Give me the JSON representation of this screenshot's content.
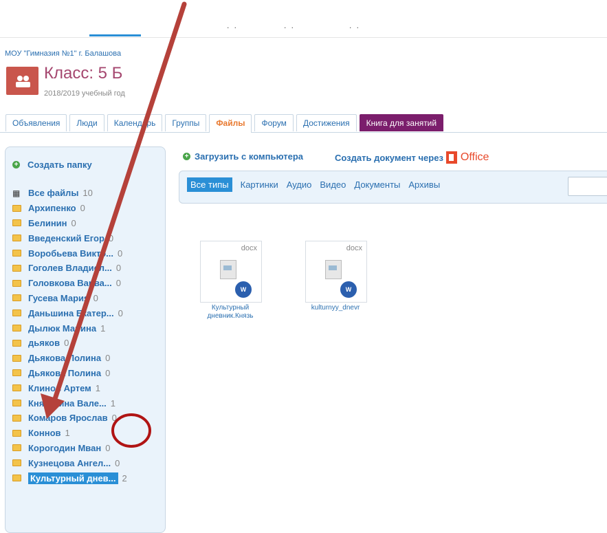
{
  "header": {
    "school": "МОУ \"Гимназия №1\" г. Балашова",
    "class_title": "Класс: 5 Б",
    "year": "2018/2019 учебный год"
  },
  "tabs": [
    {
      "label": "Объявления"
    },
    {
      "label": "Люди"
    },
    {
      "label": "Календарь"
    },
    {
      "label": "Группы"
    },
    {
      "label": "Файлы"
    },
    {
      "label": "Форум"
    },
    {
      "label": "Достижения"
    },
    {
      "label": "Книга для занятий"
    }
  ],
  "sidebar": {
    "create_folder": "Создать папку",
    "all_files": {
      "name": "Все файлы",
      "count": "10"
    },
    "folders": [
      {
        "name": "Архипенко",
        "count": "0"
      },
      {
        "name": "Белинин",
        "count": "0"
      },
      {
        "name": "Введенский Егор",
        "count": "0"
      },
      {
        "name": "Воробьева Викто...",
        "count": "0"
      },
      {
        "name": "Гоголев Владисл...",
        "count": "0"
      },
      {
        "name": "Головкова Варва...",
        "count": "0"
      },
      {
        "name": "Гусева Мария",
        "count": "0"
      },
      {
        "name": "Даньшина Екатер...",
        "count": "0"
      },
      {
        "name": "Дылюк Марина",
        "count": "1"
      },
      {
        "name": "дьяков",
        "count": "0"
      },
      {
        "name": "Дьякова Полина",
        "count": "0"
      },
      {
        "name": "Дьякова Полина",
        "count": "0"
      },
      {
        "name": "Клинов Артем",
        "count": "1"
      },
      {
        "name": "Князькина Вале...",
        "count": "1"
      },
      {
        "name": "Комаров Ярослав",
        "count": "0"
      },
      {
        "name": "Коннов",
        "count": "1"
      },
      {
        "name": "Корогодин Мван",
        "count": "0"
      },
      {
        "name": "Кузнецова Ангел...",
        "count": "0"
      },
      {
        "name": "Культурный днев...",
        "count": "2"
      }
    ]
  },
  "toolbar": {
    "upload": "Загрузить с компьютера",
    "create_doc": "Создать документ через",
    "office": "Office"
  },
  "filters": [
    "Все типы",
    "Картинки",
    "Аудио",
    "Видео",
    "Документы",
    "Архивы"
  ],
  "files": [
    {
      "ext": "docx",
      "name": "Культурный дневник.Князь"
    },
    {
      "ext": "docx",
      "name": "kulturnyy_dnevr"
    }
  ],
  "annotation": {
    "arrow_color": "#b5413a",
    "circle_color": "#b01414"
  }
}
